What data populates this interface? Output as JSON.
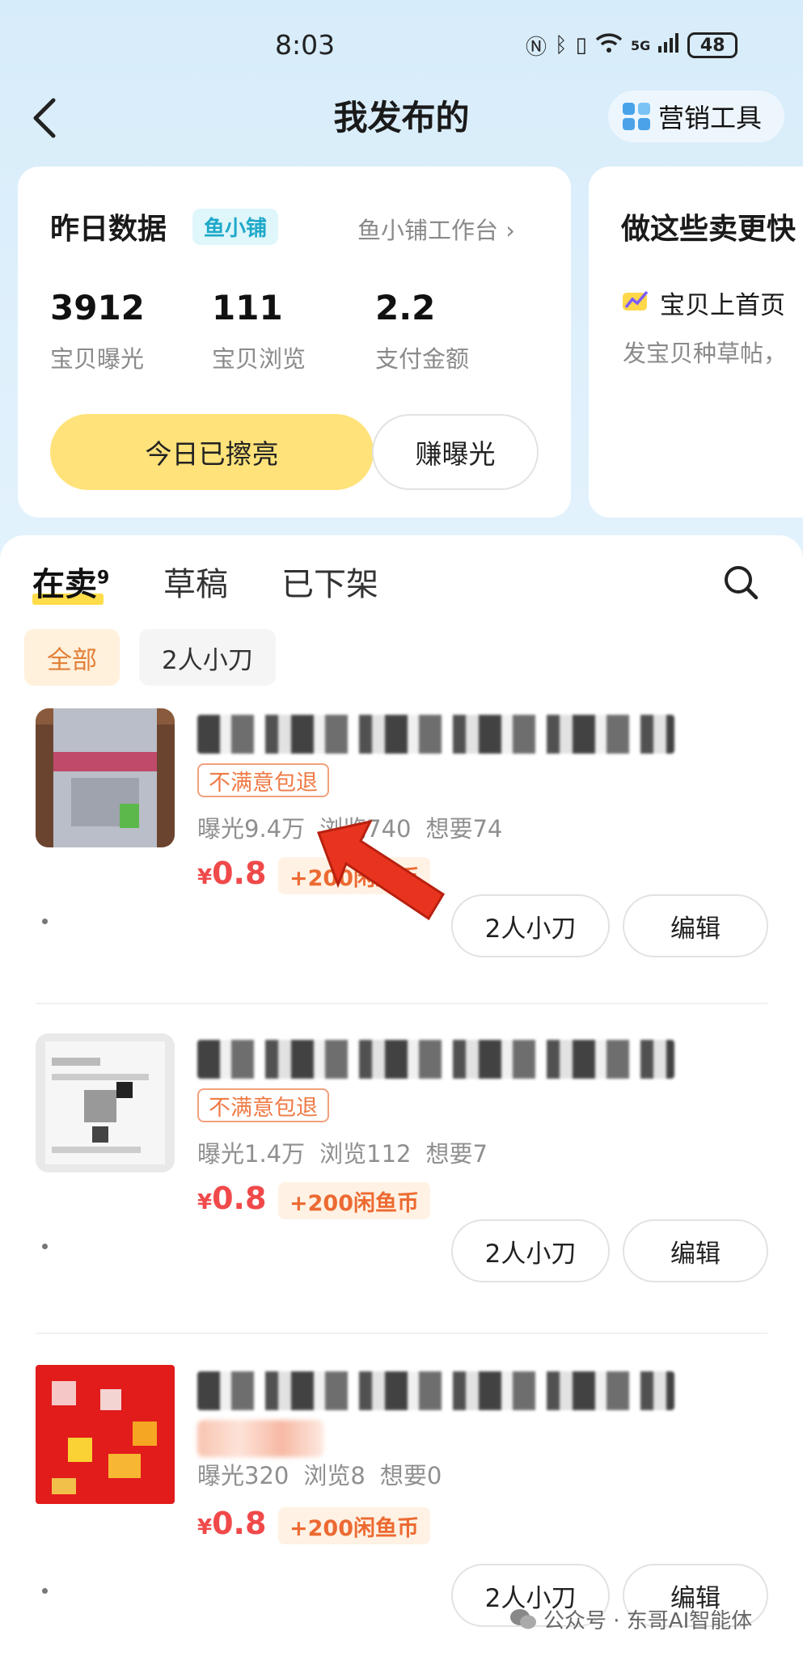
{
  "status_bar": {
    "time": "8:03",
    "network": "5G",
    "battery": "48"
  },
  "header": {
    "title": "我发布的",
    "marketing_label": "营销工具"
  },
  "yesterday_card": {
    "title": "昨日数据",
    "shop_tag": "鱼小铺",
    "workbench_link": "鱼小铺工作台",
    "metrics": [
      {
        "value": "3912",
        "label": "宝贝曝光"
      },
      {
        "value": "111",
        "label": "宝贝浏览"
      },
      {
        "value": "2.2",
        "label": "支付金额"
      }
    ],
    "primary_button": "今日已擦亮",
    "secondary_button": "赚曝光"
  },
  "tips_card": {
    "title": "做这些卖更快",
    "item": "宝贝上首页",
    "sub": "发宝贝种草帖，"
  },
  "tabs": [
    {
      "label": "在卖",
      "count": "9"
    },
    {
      "label": "草稿"
    },
    {
      "label": "已下架"
    }
  ],
  "filters": [
    {
      "label": "全部"
    },
    {
      "label": "2人小刀"
    }
  ],
  "items": [
    {
      "badge": "不满意包退",
      "exposure": "曝光9.4万",
      "views": "浏览740",
      "wants": "想要74",
      "price": "0.8",
      "coins": "+200闲鱼币",
      "knife_button": "2人小刀",
      "edit_button": "编辑"
    },
    {
      "badge": "不满意包退",
      "exposure": "曝光1.4万",
      "views": "浏览112",
      "wants": "想要7",
      "price": "0.8",
      "coins": "+200闲鱼币",
      "knife_button": "2人小刀",
      "edit_button": "编辑"
    },
    {
      "badge": "",
      "exposure": "曝光320",
      "views": "浏览8",
      "wants": "想要0",
      "price": "0.8",
      "coins": "+200闲鱼币",
      "knife_button": "2人小刀",
      "edit_button": "编辑"
    }
  ],
  "currency_symbol": "¥",
  "watermark": "公众号 · 东哥AI智能体",
  "colors": {
    "accent_yellow": "#ffe27a",
    "price_red": "#f0494a",
    "coin_orange": "#ec6a32",
    "bg_blue": "#dff0fb"
  },
  "icons": [
    "back-icon",
    "marketing-grid-icon",
    "chevron-right-icon",
    "search-icon",
    "trend-icon",
    "red-arrow-icon",
    "wechat-icon"
  ]
}
